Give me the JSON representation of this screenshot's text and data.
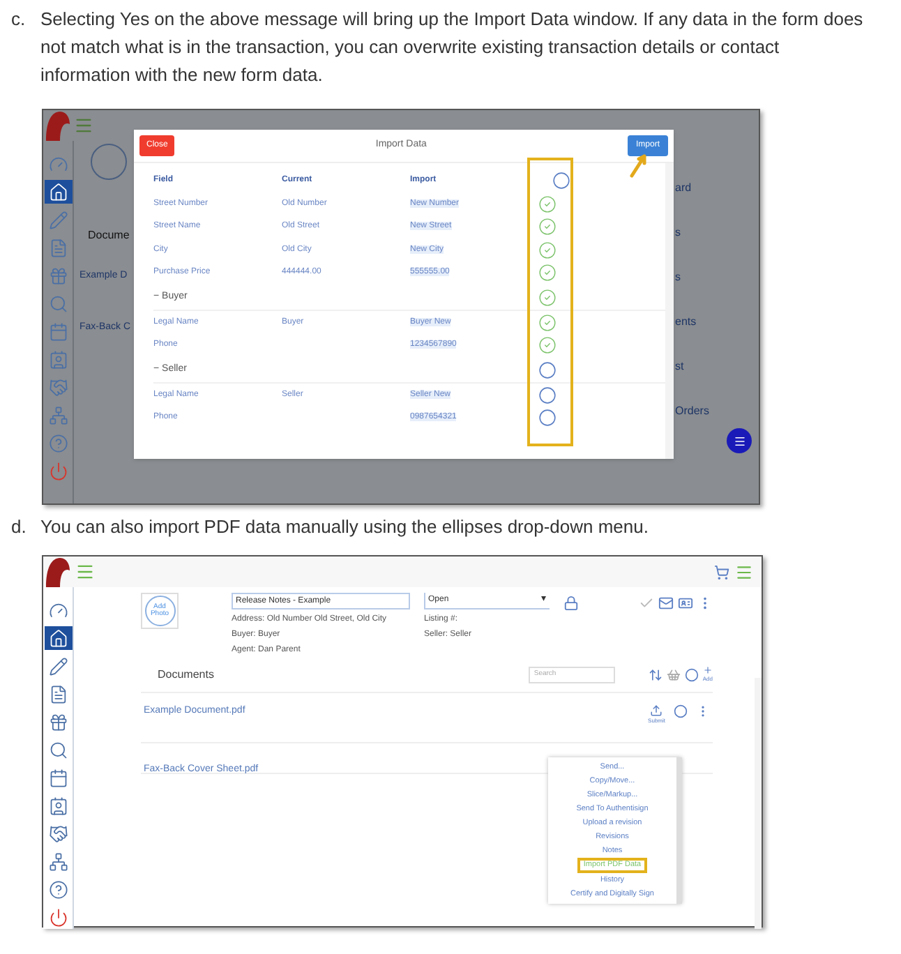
{
  "steps": [
    {
      "marker": "c.",
      "text": "Selecting Yes on the above message will bring up the Import Data window. If any data in the form does not match what is in the transaction, you can overwrite existing transaction details or contact information with the new form data."
    },
    {
      "marker": "d.",
      "text": "You can also import PDF data manually using the ellipses drop-down menu."
    }
  ],
  "shot1": {
    "sidebar": [
      {
        "selected": false
      },
      {
        "selected": true
      },
      {
        "selected": false
      },
      {
        "selected": false
      },
      {
        "selected": false
      },
      {
        "selected": false
      },
      {
        "selected": false
      },
      {
        "selected": false
      },
      {
        "selected": false
      },
      {
        "selected": false
      },
      {
        "selected": false
      },
      {
        "selected": false
      }
    ],
    "background_texts": [
      "Docume",
      "Example D",
      "Fax-Back C"
    ],
    "right_texts": [
      "ard",
      "s",
      "s",
      "ents",
      "st",
      "Orders"
    ],
    "modal": {
      "close": "Close",
      "title": "Import Data",
      "import": "Import",
      "columns": [
        "Field",
        "Current",
        "Import"
      ],
      "rows": [
        {
          "kind": "row",
          "field": "Street Number",
          "current": "Old Number",
          "import": "New Number",
          "checked": true
        },
        {
          "kind": "row",
          "field": "Street Name",
          "current": "Old Street",
          "import": "New Street",
          "checked": true
        },
        {
          "kind": "row",
          "field": "City",
          "current": "Old City",
          "import": "New City",
          "checked": true
        },
        {
          "kind": "row",
          "field": "Purchase Price",
          "current": "444444.00",
          "import": "555555.00",
          "checked": true
        },
        {
          "kind": "section",
          "prefix": "−",
          "label": "Buyer",
          "checked": true
        },
        {
          "kind": "row",
          "field": "Legal Name",
          "current": "Buyer",
          "import": "Buyer New",
          "checked": true
        },
        {
          "kind": "row",
          "field": "Phone",
          "import": "1234567890",
          "checked": true
        },
        {
          "kind": "section",
          "prefix": "−",
          "label": "Seller",
          "checked": false
        },
        {
          "kind": "row",
          "field": "Legal Name",
          "current": "Seller",
          "import": "Seller New",
          "checked": false
        },
        {
          "kind": "row",
          "field": "Phone",
          "import": "0987654321",
          "checked": false
        }
      ],
      "header_checked": false
    }
  },
  "shot2": {
    "sidebar": [
      {
        "selected": false
      },
      {
        "selected": true
      },
      {
        "selected": false
      },
      {
        "selected": false
      },
      {
        "selected": false
      },
      {
        "selected": false
      },
      {
        "selected": false
      },
      {
        "selected": false
      },
      {
        "selected": false
      },
      {
        "selected": false
      },
      {
        "selected": false
      },
      {
        "selected": false
      }
    ],
    "photo": "Add Photo",
    "title_value": "Release Notes - Example",
    "status_value": "Open",
    "caret": "▾",
    "address_lines": [
      "Address: Old Number Old Street, Old City",
      "Buyer: Buyer",
      "Agent: Dan Parent"
    ],
    "side_lines": [
      "Listing #:",
      "Seller: Seller"
    ],
    "documents_heading": "Documents",
    "search_placeholder": "Search",
    "add": "Add",
    "submit": "Submit",
    "files": [
      "Example Document.pdf",
      "Fax-Back Cover Sheet.pdf"
    ],
    "menu": [
      {
        "label": "Send...",
        "selected": false
      },
      {
        "label": "Copy/Move...",
        "selected": false
      },
      {
        "label": "Slice/Markup...",
        "selected": false
      },
      {
        "label": "Send To Authentisign",
        "selected": false
      },
      {
        "label": "Upload a revision",
        "selected": false
      },
      {
        "label": "Revisions",
        "selected": false
      },
      {
        "label": "Notes",
        "selected": false
      },
      {
        "label": "Import PDF Data",
        "selected": true
      },
      {
        "label": "History",
        "selected": false
      },
      {
        "label": "Certify and Digitally Sign",
        "selected": false
      }
    ]
  }
}
